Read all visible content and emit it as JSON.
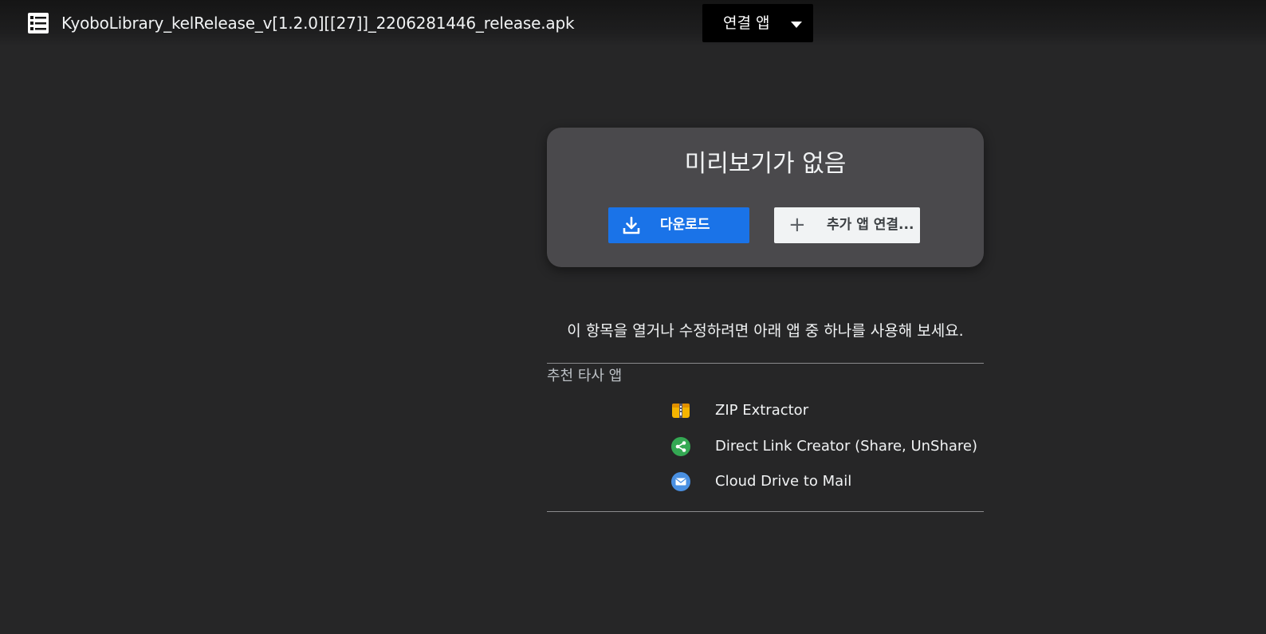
{
  "header": {
    "file_icon": "list-document-icon",
    "file_name": "KyoboLibrary_kelRelease_v[1.2.0][[27]]_2206281446_release.apk",
    "open_with_label": "연결 앱",
    "open_with_icon": "caret-down-icon"
  },
  "preview_card": {
    "title": "미리보기가 없음",
    "download_label": "다운로드",
    "download_icon": "download-icon",
    "connect_label": "추가 앱 연결...",
    "connect_icon": "plus-icon"
  },
  "hint_text": "이 항목을 열거나 수정하려면 아래 앱 중 하나를 사용해 보세요.",
  "suggested": {
    "label": "추천 타사 앱",
    "apps": [
      {
        "name": "ZIP Extractor",
        "icon": "zip-extractor-icon"
      },
      {
        "name": "Direct Link Creator (Share, UnShare)",
        "icon": "share-icon"
      },
      {
        "name": "Cloud Drive to Mail",
        "icon": "mail-icon"
      }
    ]
  },
  "colors": {
    "background": "#262627",
    "card": "#4a494c",
    "primary_button": "#1a73e8",
    "share_green": "#34a853",
    "mail_blue": "#4a90e2"
  }
}
